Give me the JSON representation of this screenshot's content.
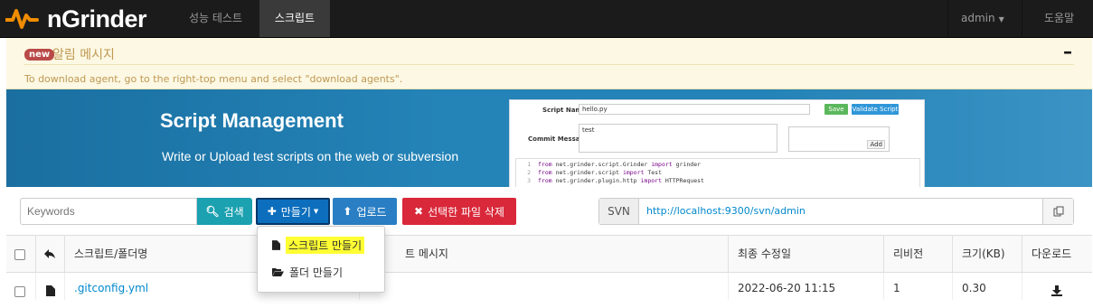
{
  "nav": {
    "brand": "nGrinder",
    "items": [
      {
        "label": "성능 테스트"
      },
      {
        "label": "스크립트"
      }
    ],
    "user": "admin",
    "help": "도움말"
  },
  "alert": {
    "badge": "new",
    "title": "알림 메시지",
    "collapse": "–",
    "message": "To download agent, go to the right-top menu and select \"download agents\"."
  },
  "banner": {
    "title": "Script Management",
    "subtitle": "Write or Upload test scripts on the web or subversion",
    "shot": {
      "script_name_label": "Script Name",
      "script_name_value": "hello.py",
      "save": "Save",
      "validate": "Validate Script",
      "commit_label": "Commit Message",
      "commit_value": "test",
      "add": "Add",
      "code": [
        {
          "n": "1",
          "a": "from",
          "b": " net.grinder.script.Grinder ",
          "c": "import",
          "d": " grinder"
        },
        {
          "n": "2",
          "a": "from",
          "b": " net.grinder.script ",
          "c": "import",
          "d": " Test"
        },
        {
          "n": "3",
          "a": "from",
          "b": " net.grinder.plugin.http ",
          "c": "import",
          "d": " HTTPRequest"
        }
      ]
    }
  },
  "toolbar": {
    "search_placeholder": "Keywords",
    "search": "검색",
    "create": "만들기",
    "upload": "업로드",
    "delete": "선택한 파일 삭제",
    "svn_label": "SVN",
    "svn_url": "http://localhost:9300/svn/admin"
  },
  "dropdown": {
    "create_script": "스크립트 만들기",
    "create_folder": "폴더 만들기"
  },
  "table": {
    "headers": {
      "name": "스크립트/폴더명",
      "commit": "커밋 메시지",
      "commit_visible": "트 메시지",
      "modified": "최종 수정일",
      "revision": "리비전",
      "size": "크기(KB)",
      "download": "다운로드"
    },
    "rows": [
      {
        "name": ".gitconfig.yml",
        "commit": "",
        "modified": "2022-06-20 11:15",
        "revision": "1",
        "size": "0.30"
      }
    ]
  },
  "colors": {
    "search": "#1ba1b0",
    "create": "#0d6ebd",
    "upload": "#2a7fc4",
    "delete": "#d9283a",
    "brand_orange": "#f08c00"
  }
}
